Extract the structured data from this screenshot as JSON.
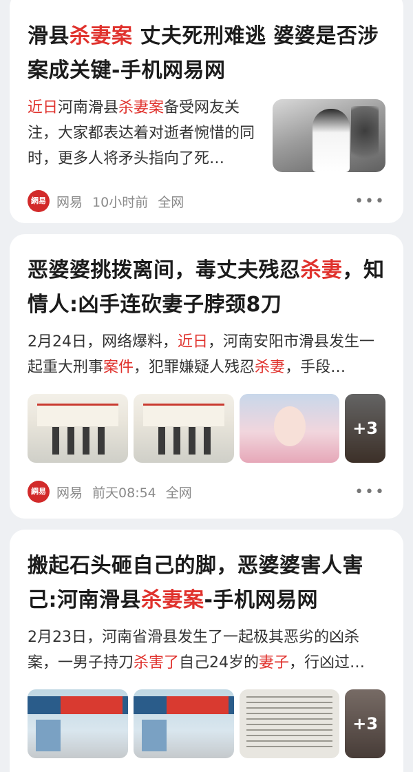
{
  "articles": [
    {
      "title_parts": [
        "滑县",
        "杀妻案",
        " 丈夫死刑难逃 婆婆是否涉案成关键-手机网易网"
      ],
      "snippet_parts": [
        "近日",
        "河南滑县",
        "杀妻案",
        "备受网友关注，大家都表达着对逝者惋惜的同时，更多人将矛头指向了死…"
      ],
      "source": "网易",
      "time": "10小时前",
      "scope": "全网",
      "logo_text": "網易"
    },
    {
      "title_parts": [
        "恶婆婆挑拨离间，毒丈夫残忍",
        "杀妻",
        "，知情人:凶手连砍妻子脖颈8刀"
      ],
      "snippet_parts": [
        "2月24日，网络爆料，",
        "近日",
        "，河南安阳市滑县发生一起重大刑事",
        "案件",
        "，犯罪嫌疑人残忍",
        "杀妻",
        "，手段…"
      ],
      "extra_count": "+3",
      "source": "网易",
      "time": "前天08:54",
      "scope": "全网",
      "logo_text": "網易"
    },
    {
      "title_parts": [
        "搬起石头砸自己的脚，恶婆婆害人害己:河南滑县",
        "杀妻案",
        "-手机网易网"
      ],
      "snippet_parts": [
        "2月23日，河南省滑县发生了一起极其恶劣的凶杀案，一男子持刀",
        "杀害了",
        "自己24岁的",
        "妻子",
        "，行凶过…"
      ],
      "extra_count": "+3"
    }
  ],
  "icons": {
    "more": "more-dots-icon",
    "logo": "netease-logo-icon"
  },
  "colors": {
    "highlight": "#e0322d",
    "background": "#eef0f3",
    "card": "#ffffff"
  }
}
